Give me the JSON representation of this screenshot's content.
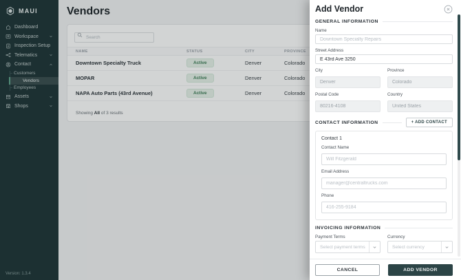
{
  "colors": {
    "sidebar_bg": "#22383a",
    "accent_teal": "#2c4446",
    "badge_green_bg": "#e7f2ea",
    "badge_green_text": "#3e7d57"
  },
  "sidebar": {
    "brand": "MAUI",
    "items": [
      {
        "label": "Dashboard",
        "icon": "home-icon",
        "chevron": null
      },
      {
        "label": "Workspace",
        "icon": "workspace-icon",
        "chevron": "down"
      },
      {
        "label": "Inspection Setup",
        "icon": "inspection-icon",
        "chevron": null
      },
      {
        "label": "Telematics",
        "icon": "telematics-icon",
        "chevron": "down"
      },
      {
        "label": "Contact",
        "icon": "contact-icon",
        "chevron": "up"
      },
      {
        "label": "Assets",
        "icon": "assets-icon",
        "chevron": "down"
      },
      {
        "label": "Shops",
        "icon": "shops-icon",
        "chevron": "down"
      }
    ],
    "contact_submenu": [
      {
        "label": "Customers",
        "active": false
      },
      {
        "label": "Vendors",
        "active": true
      },
      {
        "label": "Employees",
        "active": false
      }
    ],
    "version": "Version: 1.3.4"
  },
  "main": {
    "title": "Vendors",
    "search_placeholder": "Search",
    "table": {
      "columns": [
        "NAME",
        "STATUS",
        "CITY",
        "PROVINCE"
      ],
      "rows": [
        {
          "name": "Downtown Specialty Truck",
          "status": "Active",
          "city": "Denver",
          "province": "Colorado"
        },
        {
          "name": "MOPAR",
          "status": "Active",
          "city": "Denver",
          "province": "Colorado"
        },
        {
          "name": "NAPA Auto Parts (43rd Avenue)",
          "status": "Active",
          "city": "Denver",
          "province": "Colorado"
        }
      ],
      "footer": {
        "showing": "Showing",
        "all": "All",
        "results": "of 3 results"
      }
    }
  },
  "drawer": {
    "title": "Add Vendor",
    "general": {
      "heading": "GENERAL INFORMATION",
      "name": {
        "label": "Name",
        "placeholder": "Downtown Specialty Repairs"
      },
      "street": {
        "label": "Street Address",
        "value": "E 43rd Ave 3250"
      },
      "city": {
        "label": "City",
        "value": "Denver"
      },
      "province": {
        "label": "Province",
        "value": "Colorado"
      },
      "postal": {
        "label": "Postal Code",
        "value": "80216-4108"
      },
      "country": {
        "label": "Country",
        "value": "United States"
      }
    },
    "contact": {
      "heading": "CONTACT INFORMATION",
      "add_button": "+ ADD CONTACT",
      "card_title": "Contact 1",
      "name": {
        "label": "Contact Name",
        "placeholder": "Will Fitzgerald"
      },
      "email": {
        "label": "Email Address",
        "placeholder": "manager@centraltrucks.com"
      },
      "phone": {
        "label": "Phone",
        "placeholder": "416-255-9184"
      }
    },
    "invoicing": {
      "heading": "INVOICING INFORMATION",
      "payment_terms": {
        "label": "Payment Terms",
        "placeholder": "Select payment terms"
      },
      "currency": {
        "label": "Currency",
        "placeholder": "Select currency"
      }
    },
    "footer": {
      "cancel": "CANCEL",
      "submit": "ADD VENDOR"
    }
  }
}
